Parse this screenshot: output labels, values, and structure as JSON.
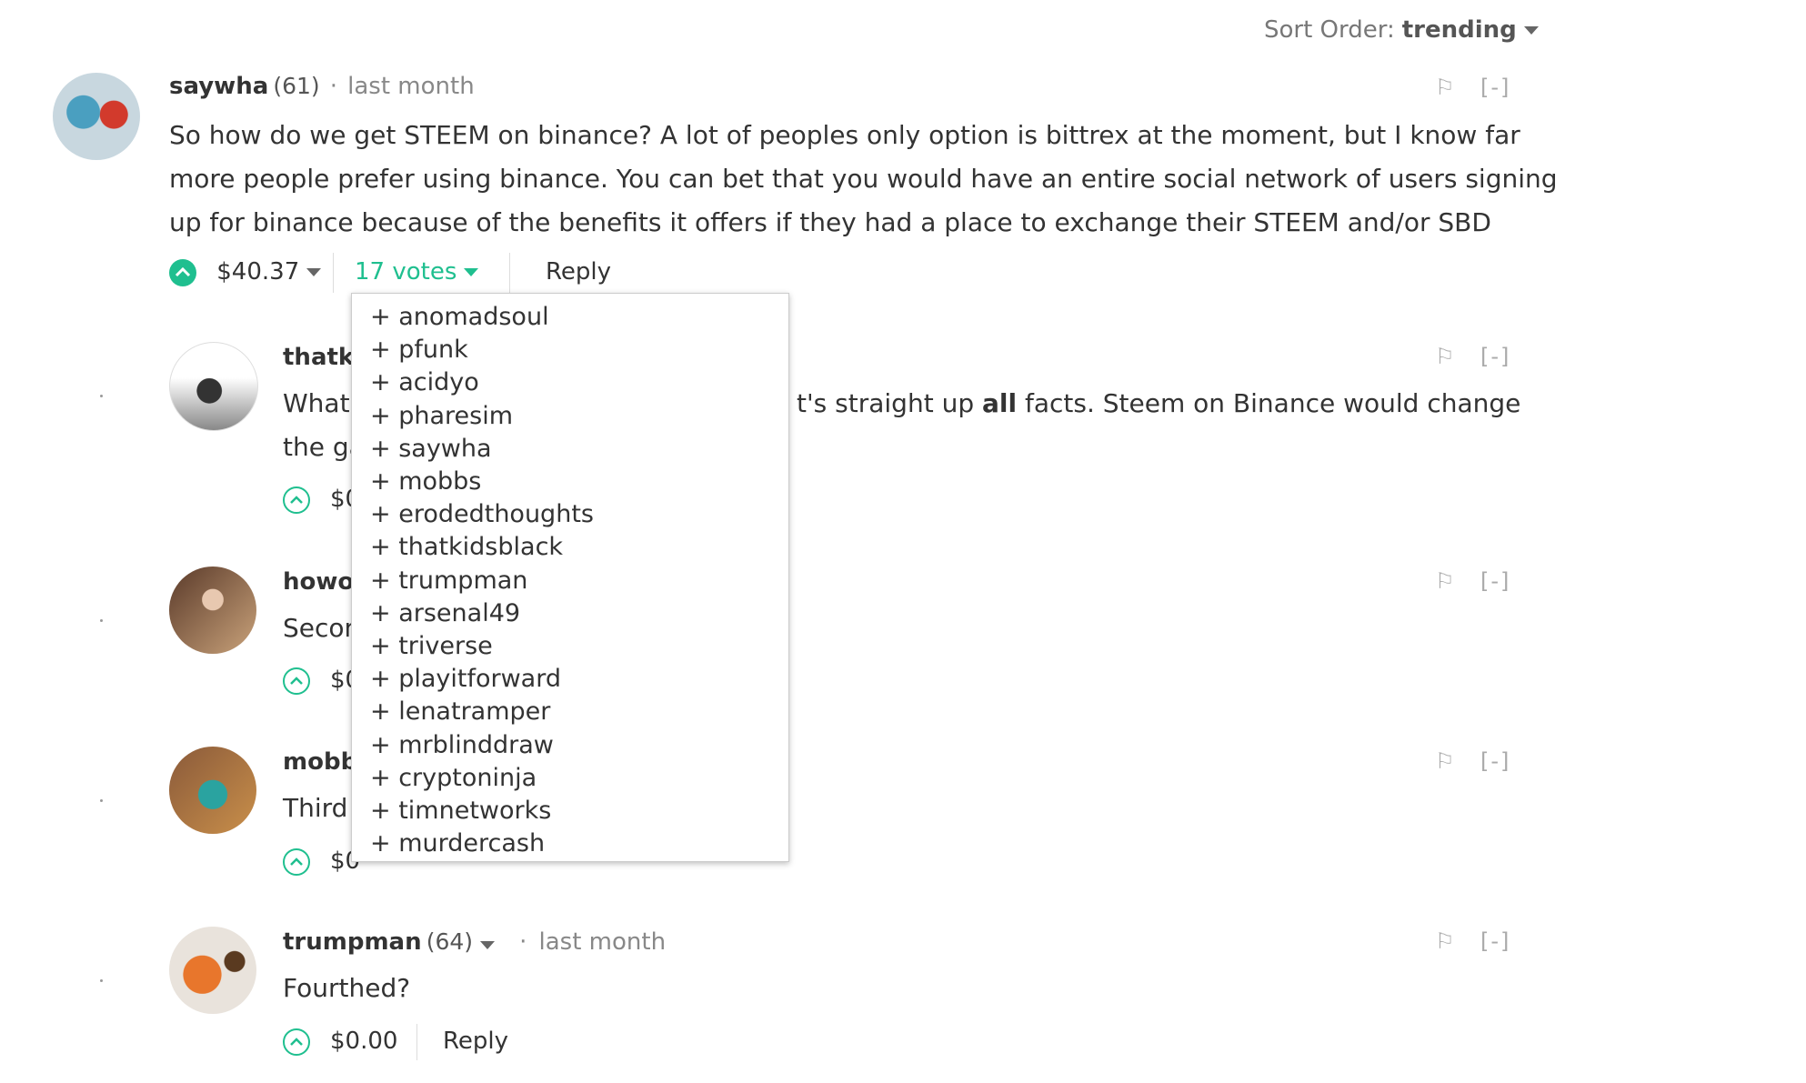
{
  "sort": {
    "label": "Sort Order:",
    "value": "trending"
  },
  "main_comment": {
    "author": "saywha",
    "reputation": "(61)",
    "separator": "·",
    "time": "last month",
    "body_lines": [
      "So how do we get STEEM on binance? A lot of peoples only option is bittrex at the moment, but I know far",
      "more people prefer using binance. You can bet that you would have an entire social network of users signing",
      "up for binance because of the benefits it offers if they had a place to exchange their STEEM and/or SBD"
    ],
    "payout": "$40.37",
    "votes": "17 votes",
    "reply": "Reply",
    "flag_icon": "flag-icon",
    "collapse": "[-]"
  },
  "voters_dropdown": {
    "items": [
      "+ anomadsoul",
      "+ pfunk",
      "+ acidyo",
      "+ pharesim",
      "+ saywha",
      "+ mobbs",
      "+ erodedthoughts",
      "+ thatkidsblack",
      "+ trumpman",
      "+ arsenal49",
      "+ triverse",
      "+ playitforward",
      "+ lenatramper",
      "+ mrblinddraw",
      "+ cryptoninja",
      "+ timnetworks",
      "+ murdercash"
    ]
  },
  "replies": [
    {
      "author": "thatki",
      "body_line1_before": "What'",
      "body_line1_after_a": "t's straight up ",
      "body_line1_bold": "all",
      "body_line1_after_b": " facts. Steem on Binance would change",
      "body_line2": "the ga",
      "payout": "$0",
      "collapse": "[-]"
    },
    {
      "author": "howo",
      "body": "Secon",
      "payout": "$0",
      "collapse": "[-]"
    },
    {
      "author": "mobb",
      "body": "Third",
      "payout": "$0",
      "collapse": "[-]"
    },
    {
      "author": "trumpman",
      "reputation": "(64)",
      "separator": "·",
      "time": "last month",
      "body": "Fourthed?",
      "payout": "$0.00",
      "reply": "Reply",
      "collapse": "[-]"
    }
  ],
  "colors": {
    "accent": "#1fbf8f",
    "text": "#333333",
    "muted": "#888888"
  }
}
